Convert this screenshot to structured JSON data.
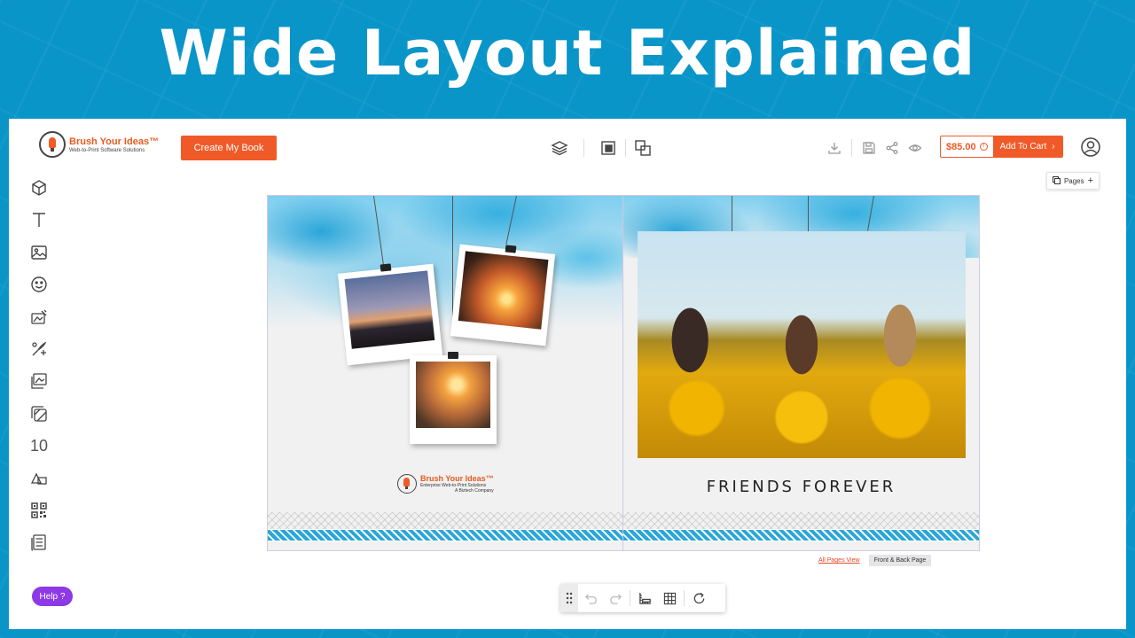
{
  "banner": {
    "title": "Wide Layout Explained"
  },
  "header": {
    "logo_name": "Brush Your Ideas™",
    "logo_tagline": "Web-to-Print Software Solutions",
    "create_button": "Create My Book",
    "price": "$85.00",
    "cart_button": "Add To Cart",
    "pages_button": "Pages"
  },
  "sidebar": {
    "page_number_tool": "10",
    "help_button": "Help ?"
  },
  "spread": {
    "left_brand_name": "Brush Your Ideas™",
    "left_brand_tagline": "Enterprise Web-to-Print Solutions",
    "left_brand_sub": "A Biztech Company",
    "right_caption": "FRIENDS FOREVER"
  },
  "view_links": {
    "all_pages": "All Pages View",
    "front_back": "Front & Back Page"
  },
  "colors": {
    "accent": "#f05a28",
    "banner_bg": "#0a95c9",
    "help": "#8d39e6"
  },
  "icons": {
    "sidebar": [
      "cube-icon",
      "text-icon",
      "image-icon",
      "emoji-icon",
      "background-icon",
      "clipart-icon",
      "frame-icon",
      "layouts-icon",
      "page-number-tool",
      "shape-icon",
      "qr-code-icon",
      "table-icon"
    ],
    "center": [
      "layers-icon",
      "bring-front-icon",
      "send-back-icon"
    ],
    "right": [
      "download-icon",
      "save-icon",
      "share-icon",
      "preview-icon",
      "user-icon"
    ],
    "bottom": [
      "drag-handle-icon",
      "undo-icon",
      "redo-icon",
      "ruler-icon",
      "grid-icon",
      "refresh-icon"
    ]
  }
}
